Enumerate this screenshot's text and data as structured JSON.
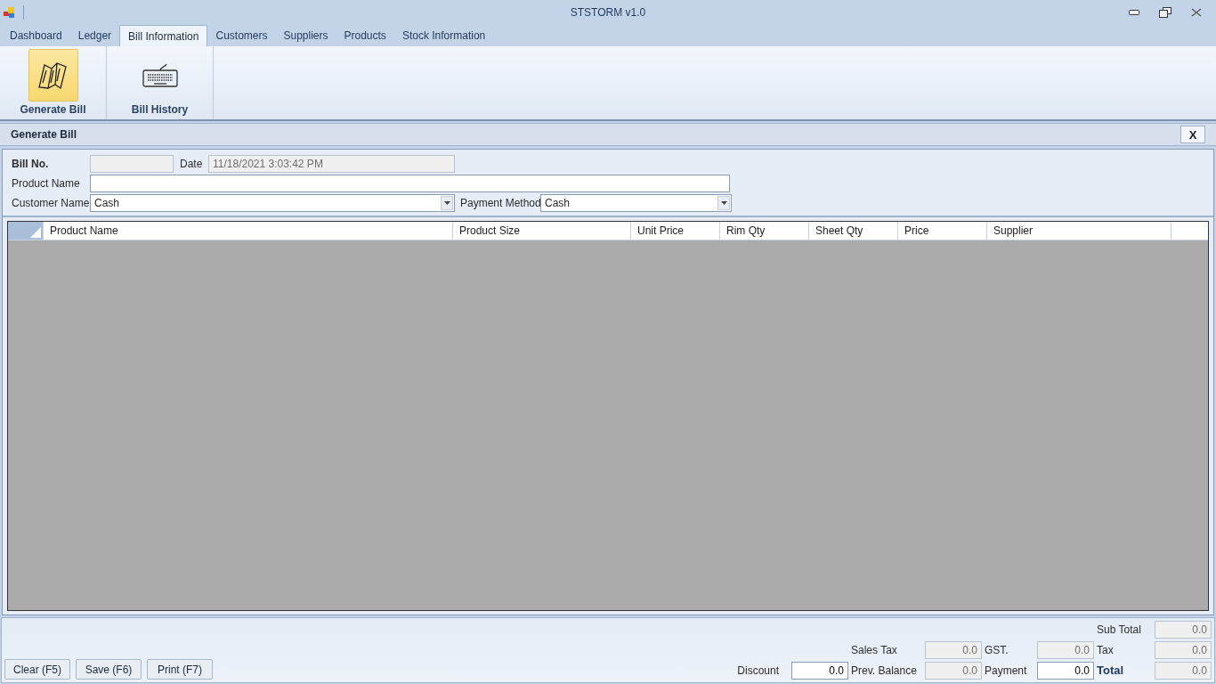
{
  "window": {
    "title": "STSTORM v1.0"
  },
  "tabs": [
    {
      "label": "Dashboard",
      "selected": false
    },
    {
      "label": "Ledger",
      "selected": false
    },
    {
      "label": "Bill Information",
      "selected": true
    },
    {
      "label": "Customers",
      "selected": false
    },
    {
      "label": "Suppliers",
      "selected": false
    },
    {
      "label": "Products",
      "selected": false
    },
    {
      "label": "Stock Information",
      "selected": false
    }
  ],
  "ribbon": [
    {
      "kind": "map",
      "label": "Generate Bill",
      "selected": true
    },
    {
      "kind": "keyboard",
      "label": "Bill History",
      "selected": false
    }
  ],
  "panel": {
    "title": "Generate Bill",
    "close": "X"
  },
  "form": {
    "bill_no": {
      "label": "Bill No."
    },
    "date": {
      "label": "Date",
      "value": "11/18/2021 3:03:42 PM"
    },
    "product_name": {
      "label": "Product Name"
    },
    "customer_name": {
      "label": "Customer Name",
      "value": "Cash"
    },
    "payment_method": {
      "label": "Payment Method",
      "value": "Cash"
    }
  },
  "table": {
    "columns": [
      "Product Name",
      "Product Size",
      "Unit Price",
      "Rim Qty",
      "Sheet Qty",
      "Price",
      "Supplier"
    ]
  },
  "buttons": [
    "Clear (F5)",
    "Save (F6)",
    "Print (F7)"
  ],
  "totals": [
    [
      {
        "label": "Sub Total",
        "value": "0.0",
        "editable": false,
        "bold": false
      }
    ],
    [
      {
        "label": "Sales Tax",
        "value": "0.0",
        "editable": false,
        "bold": false
      },
      {
        "label": "GST.",
        "value": "0.0",
        "editable": false,
        "bold": false
      },
      {
        "label": "Tax",
        "value": "0.0",
        "editable": false,
        "bold": false
      }
    ],
    [
      {
        "label": "Discount",
        "value": "0.0",
        "editable": true,
        "bold": false
      },
      {
        "label": "Prev. Balance",
        "value": "0.0",
        "editable": false,
        "bold": false
      },
      {
        "label": "Payment",
        "value": "0.0",
        "editable": true,
        "bold": false
      },
      {
        "label": "Total",
        "value": "0.0",
        "editable": false,
        "bold": true
      }
    ]
  ]
}
